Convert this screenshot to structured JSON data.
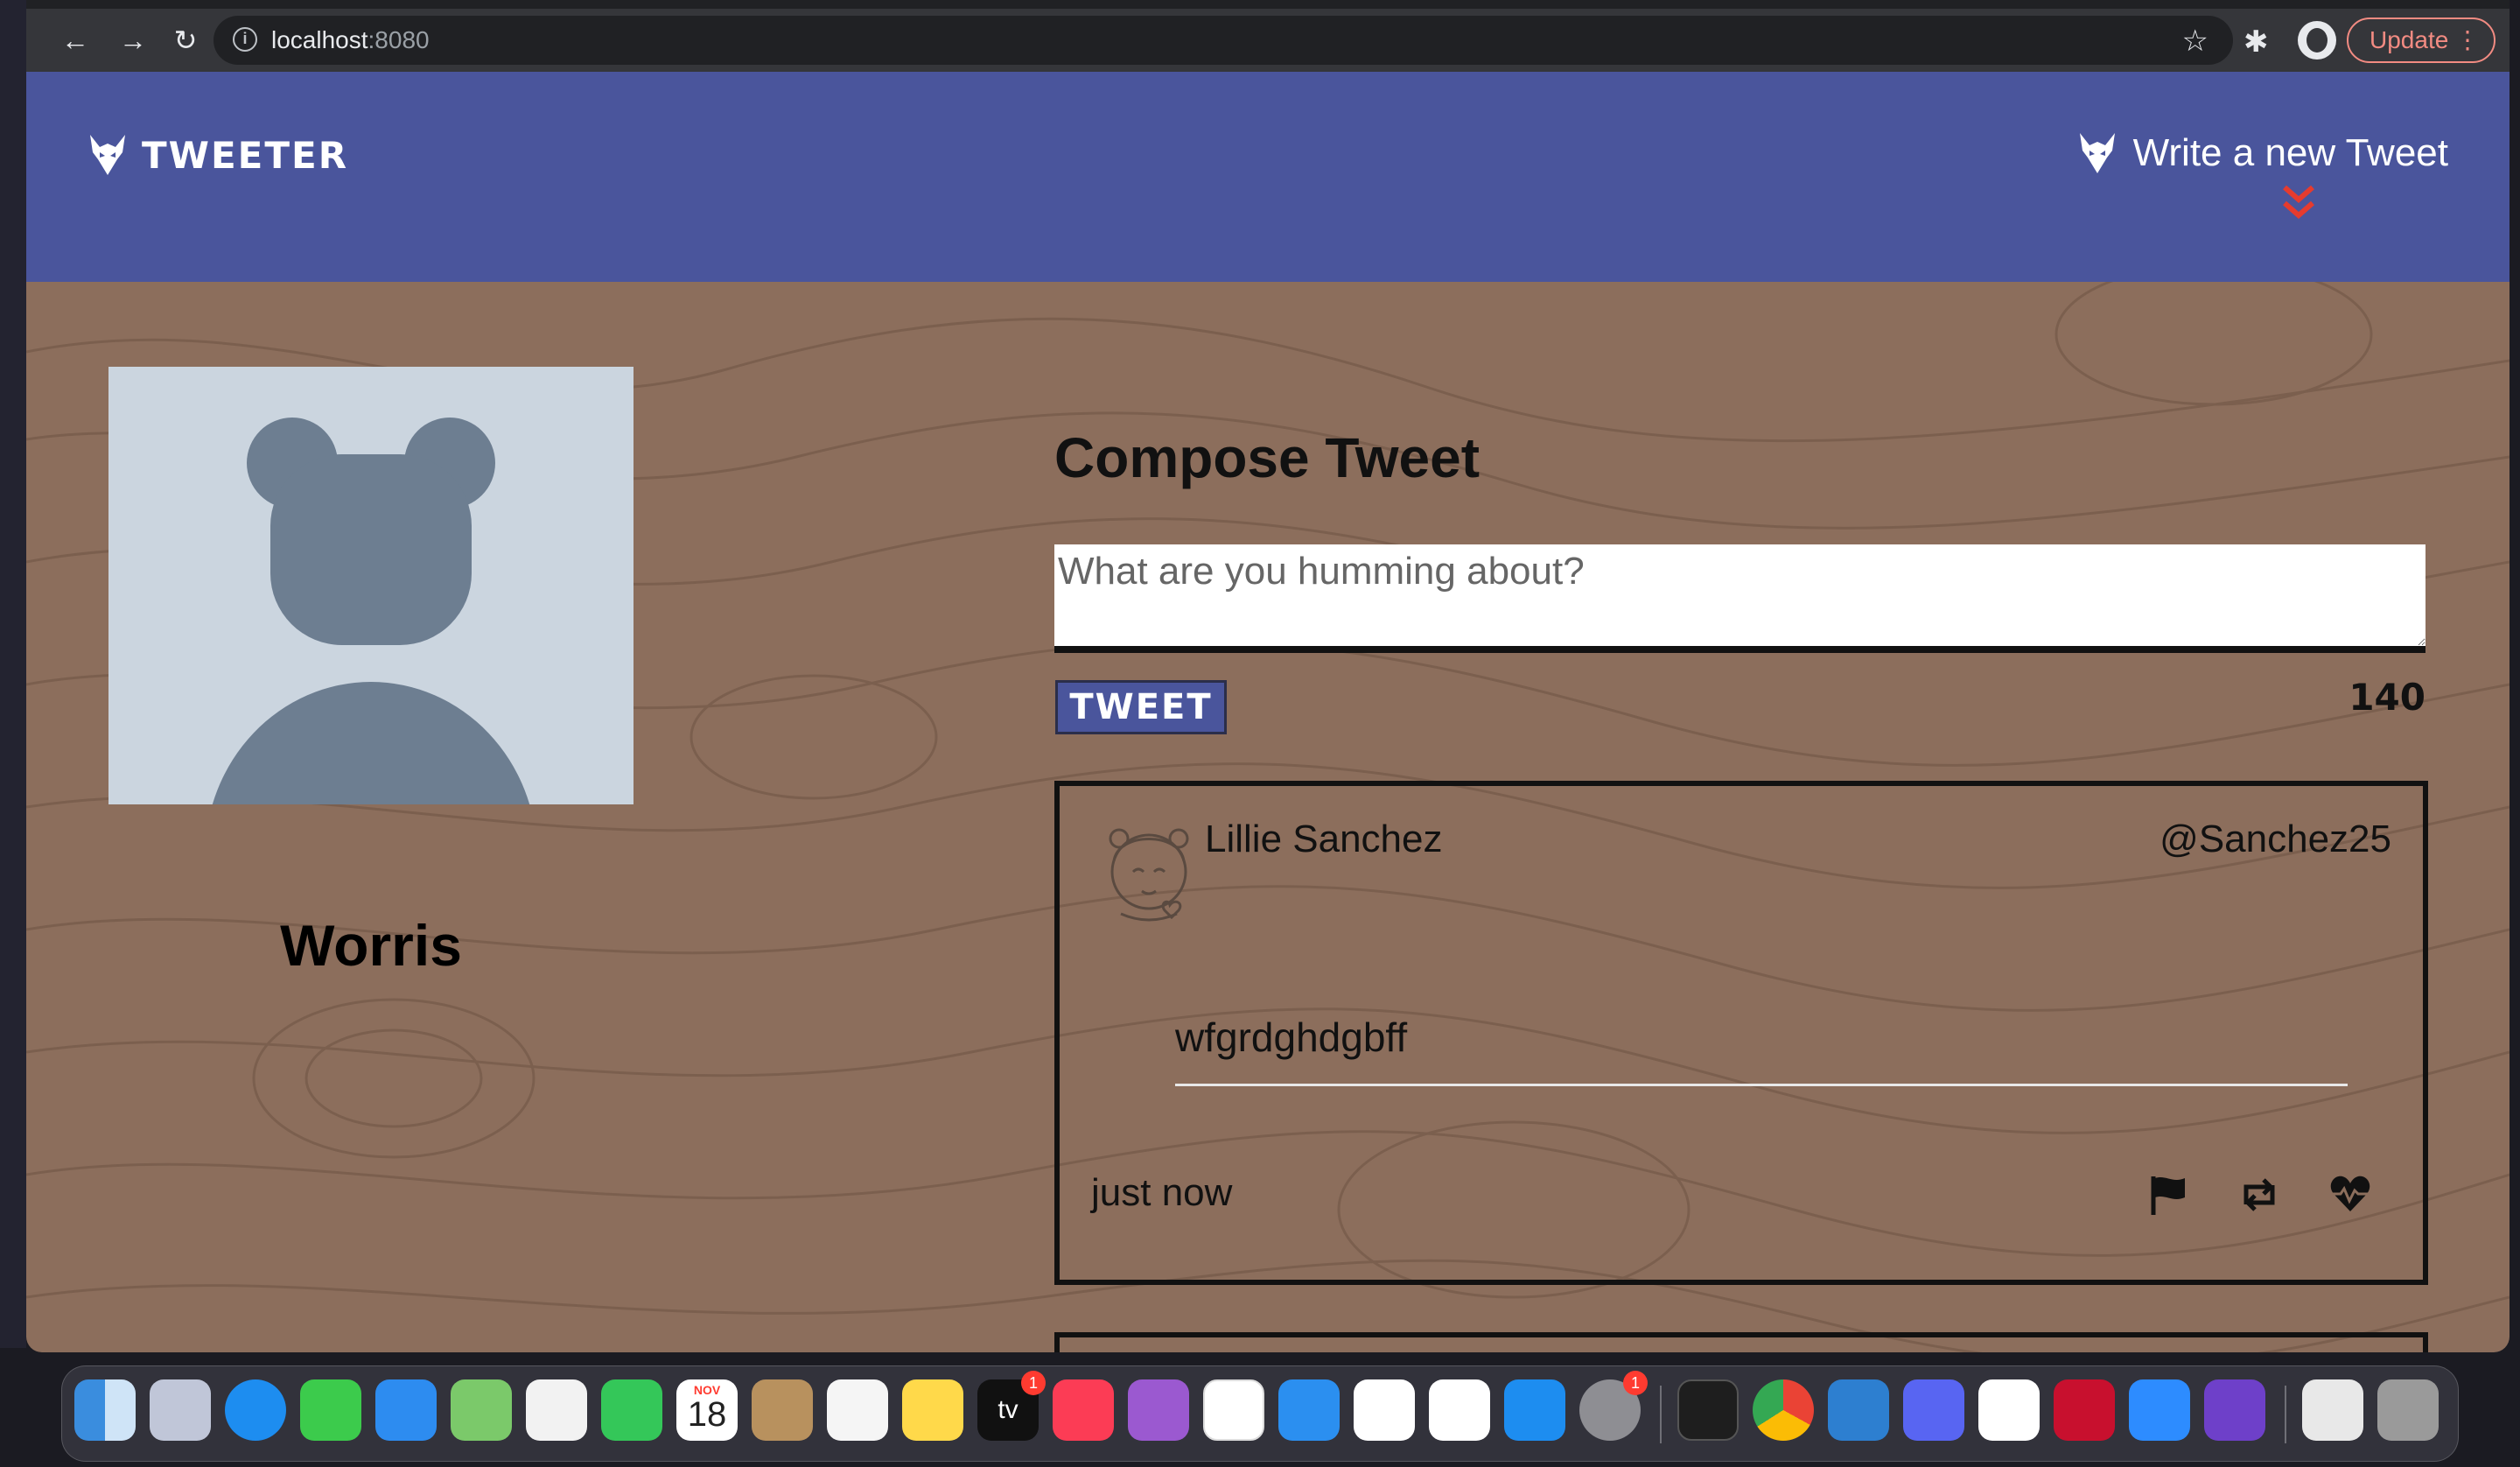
{
  "browser": {
    "url_host": "localhost",
    "url_port": ":8080",
    "update_label": "Update"
  },
  "header": {
    "logo_text": "TWEETER",
    "write_link": "Write a new Tweet"
  },
  "profile": {
    "name": "Worris"
  },
  "compose": {
    "title": "Compose Tweet",
    "placeholder": "What are you humming about?",
    "button_label": "TWEET",
    "counter": "140"
  },
  "tweets": [
    {
      "name": "Lillie Sanchez",
      "handle": "@Sanchez25",
      "body": "wfgrdghdgbff",
      "time": "just now"
    }
  ],
  "dock": {
    "calendar_month": "NOV",
    "calendar_day": "18",
    "tv_badge": "1",
    "settings_badge": "1",
    "tv_label": "tv"
  },
  "colors": {
    "header_bg": "#4a559c",
    "page_bg": "#8c6e5c",
    "accent_red": "#e63b2e"
  }
}
